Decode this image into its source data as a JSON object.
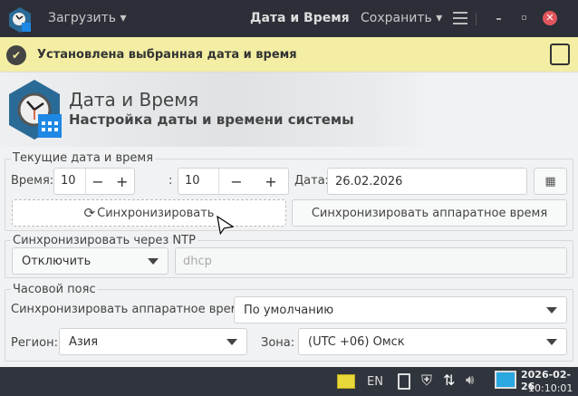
{
  "titlebar": {
    "load": "Загрузить",
    "title": "Дата и Время",
    "save": "Сохранить"
  },
  "notice": {
    "text": "Установлена выбранная дата и время"
  },
  "header": {
    "title": "Дата и Время",
    "subtitle": "Настройка даты и времени системы"
  },
  "datetime": {
    "group": "Текущие дата и время",
    "time_label": "Время:",
    "hours": "10",
    "minutes": "10",
    "separator": ":",
    "minus": "−",
    "plus": "+",
    "date_label": "Дата:",
    "date": "26.02.2026",
    "sync": "Синхронизировать",
    "sync_hw": "Синхронизировать аппаратное время"
  },
  "ntp": {
    "group": "Синхронизировать через NTP",
    "mode": "Отключить",
    "server_placeholder": "dhcp"
  },
  "timezone": {
    "group": "Часовой пояс",
    "hw_label": "Синхронизировать аппаратное время:",
    "hw_value": "По умолчанию",
    "region_label": "Регион:",
    "region": "Азия",
    "zone_label": "Зона:",
    "zone": "(UTC +06) Омск"
  },
  "taskbar": {
    "lang": "EN",
    "date": "2026-02-26",
    "time": "10:10:01"
  },
  "colors": {
    "accent": "#1e88e5",
    "notice": "#f3eea3",
    "titlebar": "#2c2f38"
  }
}
